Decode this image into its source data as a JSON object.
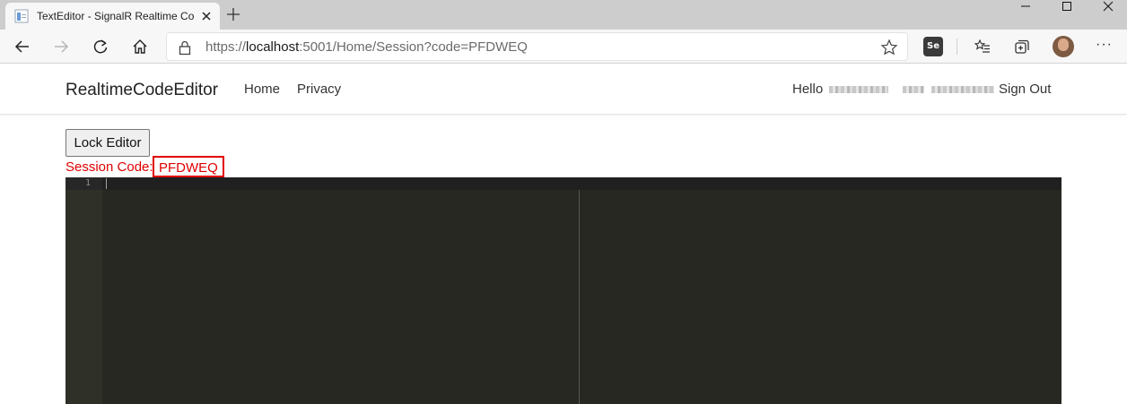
{
  "browser": {
    "tab": {
      "title": "TextEditor - SignalR Realtime Co",
      "favicon": "document-icon"
    },
    "address_bar": {
      "url_prefix": "https://",
      "url_host": "localhost",
      "url_rest": ":5001/Home/Session?code=PFDWEQ"
    },
    "extension_badge": "Se"
  },
  "site": {
    "brand": "RealtimeCodeEditor",
    "nav": {
      "home": "Home",
      "privacy": "Privacy"
    },
    "user": {
      "greeting": "Hello",
      "sign_out": "Sign Out"
    }
  },
  "content": {
    "lock_button": "Lock Editor",
    "session_label": "Session Code:",
    "session_code": "PFDWEQ"
  },
  "editor": {
    "line_numbers": [
      "1"
    ],
    "theme_bg": "#272822"
  },
  "colors": {
    "accent_red": "#e00000",
    "tab_strip": "#cdcdcd"
  }
}
